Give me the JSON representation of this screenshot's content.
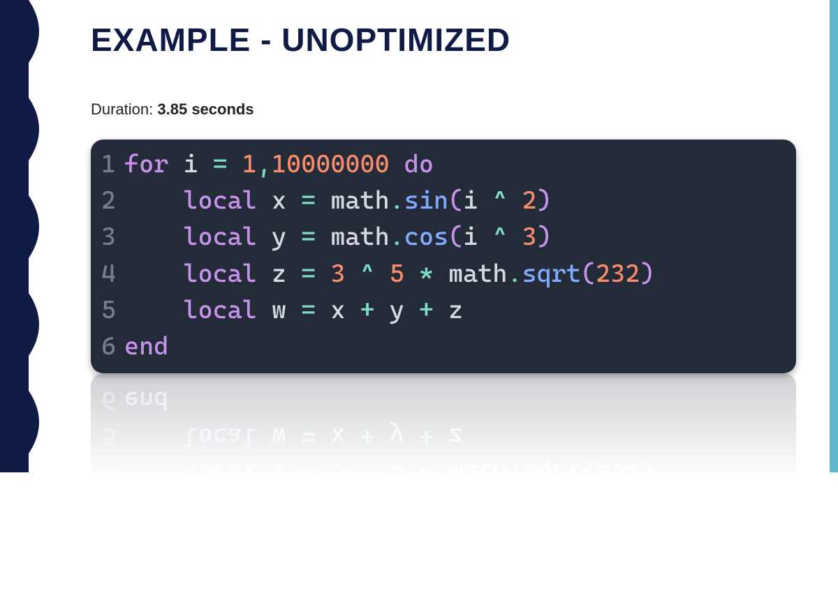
{
  "title": "EXAMPLE - UNOPTIMIZED",
  "duration_label": "Duration: ",
  "duration_value": "3.85 seconds",
  "code": {
    "lines": [
      {
        "n": "1",
        "tokens": [
          [
            "kw",
            "for"
          ],
          [
            "",
            ""
          ],
          [
            "var",
            " i "
          ],
          [
            "op",
            "="
          ],
          [
            "",
            " "
          ],
          [
            "num",
            "1"
          ],
          [
            "op",
            ","
          ],
          [
            "num",
            "10000000"
          ],
          [
            "",
            " "
          ],
          [
            "kw",
            "do"
          ]
        ]
      },
      {
        "n": "2",
        "tokens": [
          [
            "",
            "    "
          ],
          [
            "kw",
            "local"
          ],
          [
            "",
            " "
          ],
          [
            "var",
            "x "
          ],
          [
            "op",
            "="
          ],
          [
            "",
            " "
          ],
          [
            "obj",
            "math"
          ],
          [
            "op",
            "."
          ],
          [
            "mtd",
            "sin"
          ],
          [
            "par",
            "("
          ],
          [
            "var",
            "i "
          ],
          [
            "op",
            "^"
          ],
          [
            "",
            " "
          ],
          [
            "num",
            "2"
          ],
          [
            "par",
            ")"
          ]
        ]
      },
      {
        "n": "3",
        "tokens": [
          [
            "",
            "    "
          ],
          [
            "kw",
            "local"
          ],
          [
            "",
            " "
          ],
          [
            "var",
            "y "
          ],
          [
            "op",
            "="
          ],
          [
            "",
            " "
          ],
          [
            "obj",
            "math"
          ],
          [
            "op",
            "."
          ],
          [
            "mtd",
            "cos"
          ],
          [
            "par",
            "("
          ],
          [
            "var",
            "i "
          ],
          [
            "op",
            "^"
          ],
          [
            "",
            " "
          ],
          [
            "num",
            "3"
          ],
          [
            "par",
            ")"
          ]
        ]
      },
      {
        "n": "4",
        "tokens": [
          [
            "",
            "    "
          ],
          [
            "kw",
            "local"
          ],
          [
            "",
            " "
          ],
          [
            "var",
            "z "
          ],
          [
            "op",
            "="
          ],
          [
            "",
            " "
          ],
          [
            "num",
            "3"
          ],
          [
            "",
            " "
          ],
          [
            "op",
            "^"
          ],
          [
            "",
            " "
          ],
          [
            "num",
            "5"
          ],
          [
            "",
            " "
          ],
          [
            "op",
            "*"
          ],
          [
            "",
            " "
          ],
          [
            "obj",
            "math"
          ],
          [
            "op",
            "."
          ],
          [
            "mtd",
            "sqrt"
          ],
          [
            "par",
            "("
          ],
          [
            "num",
            "232"
          ],
          [
            "par",
            ")"
          ]
        ]
      },
      {
        "n": "5",
        "tokens": [
          [
            "",
            "    "
          ],
          [
            "kw",
            "local"
          ],
          [
            "",
            " "
          ],
          [
            "var",
            "w "
          ],
          [
            "op",
            "="
          ],
          [
            "",
            " "
          ],
          [
            "var",
            "x "
          ],
          [
            "op",
            "+"
          ],
          [
            "",
            " "
          ],
          [
            "var",
            "y "
          ],
          [
            "op",
            "+"
          ],
          [
            "",
            " "
          ],
          [
            "var",
            "z"
          ]
        ]
      },
      {
        "n": "6",
        "tokens": [
          [
            "kw",
            "end"
          ]
        ]
      }
    ]
  }
}
